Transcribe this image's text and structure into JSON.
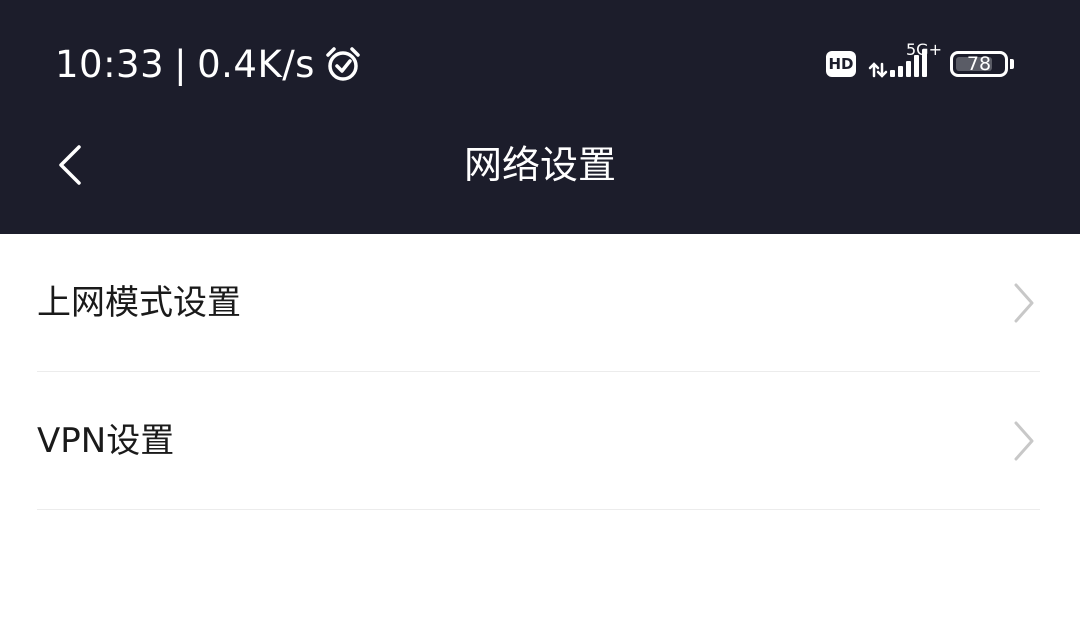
{
  "status_bar": {
    "time": "10:33",
    "separator": "|",
    "net_speed": "0.4K/s",
    "alarm_icon": "alarm-clock-icon",
    "hd_label": "HD",
    "network_type": "5G+",
    "signal_icon": "signal-bars-icon",
    "battery_level": 78,
    "battery_text": "78"
  },
  "nav": {
    "back_icon": "chevron-left-icon",
    "title": "网络设置"
  },
  "settings": {
    "items": [
      {
        "label": "上网模式设置",
        "icon": "chevron-right-icon"
      },
      {
        "label": "VPN设置",
        "icon": "chevron-right-icon"
      }
    ]
  },
  "colors": {
    "header_bg": "#1c1d2b",
    "page_bg": "#ffffff",
    "text_primary": "#1a1a1a",
    "chevron": "#c8c8c8",
    "divider": "#ececec"
  }
}
